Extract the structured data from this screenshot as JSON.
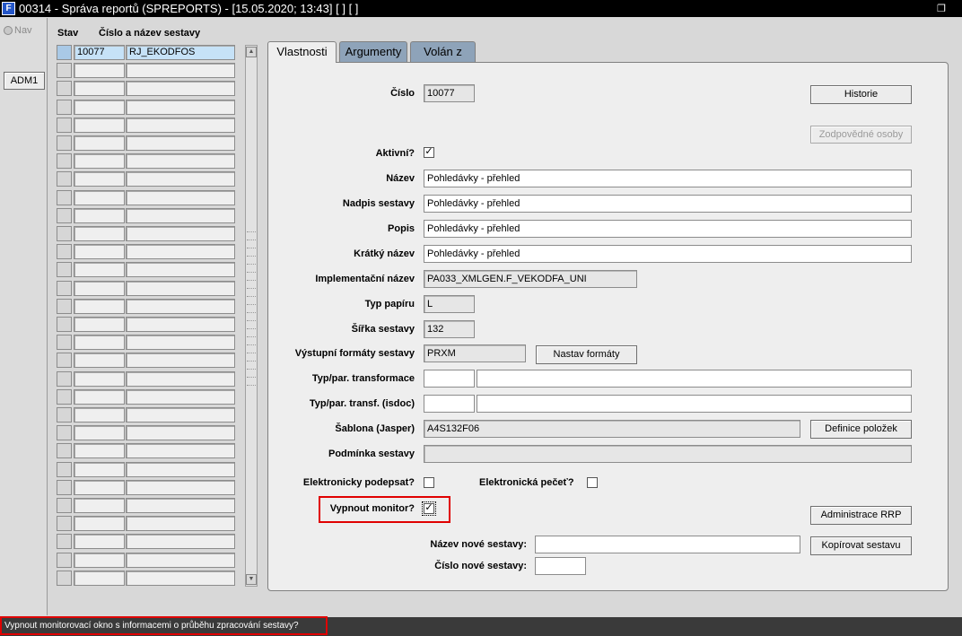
{
  "window": {
    "title": "00314 - Správa reportů (SPREPORTS) - [15.05.2020; 13:43]  [ ]  [ ]"
  },
  "toolbar": {
    "nav_label": "Nav",
    "adm_button": "ADM1"
  },
  "list": {
    "col_stav": "Stav",
    "col_name": "Číslo a název sestavy",
    "rows": [
      {
        "cislo": "10077",
        "nazev": "RJ_EKODFOS"
      },
      {
        "cislo": "",
        "nazev": ""
      },
      {
        "cislo": "",
        "nazev": ""
      },
      {
        "cislo": "",
        "nazev": ""
      },
      {
        "cislo": "",
        "nazev": ""
      },
      {
        "cislo": "",
        "nazev": ""
      },
      {
        "cislo": "",
        "nazev": ""
      },
      {
        "cislo": "",
        "nazev": ""
      },
      {
        "cislo": "",
        "nazev": ""
      },
      {
        "cislo": "",
        "nazev": ""
      },
      {
        "cislo": "",
        "nazev": ""
      },
      {
        "cislo": "",
        "nazev": ""
      },
      {
        "cislo": "",
        "nazev": ""
      },
      {
        "cislo": "",
        "nazev": ""
      },
      {
        "cislo": "",
        "nazev": ""
      },
      {
        "cislo": "",
        "nazev": ""
      },
      {
        "cislo": "",
        "nazev": ""
      },
      {
        "cislo": "",
        "nazev": ""
      },
      {
        "cislo": "",
        "nazev": ""
      },
      {
        "cislo": "",
        "nazev": ""
      },
      {
        "cislo": "",
        "nazev": ""
      },
      {
        "cislo": "",
        "nazev": ""
      },
      {
        "cislo": "",
        "nazev": ""
      },
      {
        "cislo": "",
        "nazev": ""
      },
      {
        "cislo": "",
        "nazev": ""
      },
      {
        "cislo": "",
        "nazev": ""
      },
      {
        "cislo": "",
        "nazev": ""
      },
      {
        "cislo": "",
        "nazev": ""
      },
      {
        "cislo": "",
        "nazev": ""
      },
      {
        "cislo": "",
        "nazev": ""
      }
    ]
  },
  "tabs": [
    {
      "label": "Vlastnosti",
      "active": true
    },
    {
      "label": "Argumenty",
      "active": false
    },
    {
      "label": "Volán z",
      "active": false
    }
  ],
  "form": {
    "cislo_label": "Číslo",
    "cislo_value": "10077",
    "historie_button": "Historie",
    "zodpovedne_button": "Zodpovědné osoby",
    "aktivni_label": "Aktivní?",
    "aktivni_checked": true,
    "nazev_label": "Název",
    "nazev_value": "Pohledávky - přehled",
    "nadpis_label": "Nadpis sestavy",
    "nadpis_value": "Pohledávky - přehled",
    "popis_label": "Popis",
    "popis_value": "Pohledávky - přehled",
    "kratky_label": "Krátký název",
    "kratky_value": "Pohledávky - přehled",
    "impl_label": "Implementační název",
    "impl_value": "PA033_XMLGEN.F_VEKODFA_UNI",
    "typpapiru_label": "Typ papíru",
    "typpapiru_value": "L",
    "sirka_label": "Šířka sestavy",
    "sirka_value": "132",
    "vystupni_label": "Výstupní formáty sestavy",
    "vystupni_value": "PRXM",
    "nastav_button": "Nastav formáty",
    "transf_label": "Typ/par. transformace",
    "transf_isdoc_label": "Typ/par. transf. (isdoc)",
    "sablona_label": "Šablona (Jasper)",
    "sablona_value": "A4S132F06",
    "definice_button": "Definice položek",
    "podminka_label": "Podmínka sestavy",
    "podpis_label": "Elektronicky podepsat?",
    "podpis_checked": false,
    "pecet_label": "Elektronická pečeť?",
    "pecet_checked": false,
    "monitor_label": "Vypnout monitor?",
    "monitor_checked": true,
    "admin_rrp_button": "Administrace RRP",
    "novy_nazev_label": "Název nové sestavy:",
    "kopirovat_button": "Kopírovat sestavu",
    "nove_cislo_label": "Číslo nové sestavy:"
  },
  "status": {
    "message": "Vypnout monitorovací okno s informacemi o průběhu zpracování sestavy?"
  },
  "colors": {
    "tab_inactive": "#8ea3b9",
    "selection": "#c6e2f7",
    "highlight": "#e00000",
    "titlebar": "#000000"
  }
}
